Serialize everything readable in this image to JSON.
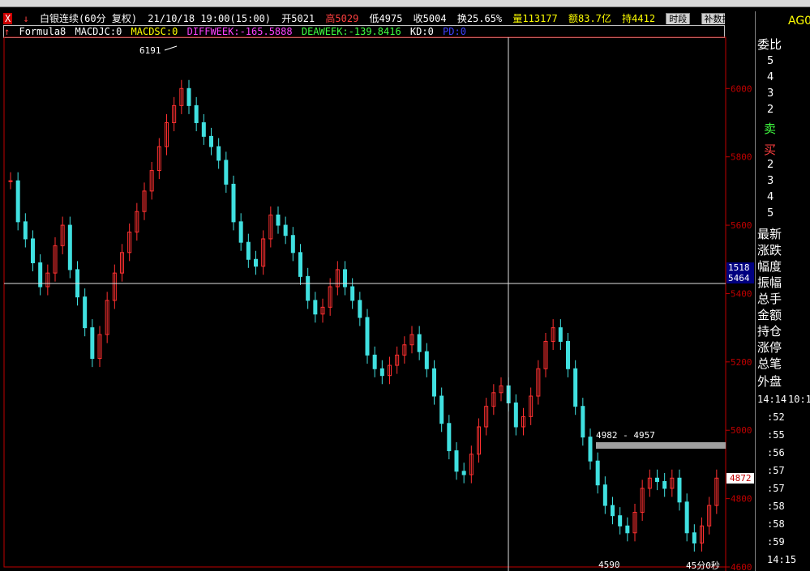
{
  "header": {
    "symbol_name": "白银连续(60分 复权)",
    "datetime": "21/10/18 19:00(15:00)",
    "open": "开5021",
    "high": "高5029",
    "low": "低4975",
    "close": "收5004",
    "turnover": "换25.65%",
    "volume": "量113177",
    "amount": "额83.7亿",
    "position": "持4412",
    "btn_period": "时段",
    "btn_fill": "补数据"
  },
  "formula": {
    "name": "Formula8",
    "macdjc": "MACDJC:0",
    "macdsc": "MACDSC:0",
    "diffweek": "DIFFWEEK:-165.5888",
    "deaweek": "DEAWEEK:-139.8416",
    "kd": "KD:0",
    "pd": "PD:0"
  },
  "panel": {
    "code": "AG0",
    "weibi": "委比",
    "sell": "卖",
    "buy": "买",
    "levels": [
      "5",
      "4",
      "3",
      "2",
      "2",
      "3",
      "4",
      "5"
    ],
    "fields": [
      "最新",
      "涨跌",
      "幅度",
      "振幅",
      "总手",
      "金额",
      "持仓",
      "涨停",
      "总笔"
    ],
    "outer": "外盘",
    "times": [
      "14:14",
      "10:1",
      ":52",
      ":55",
      ":56",
      ":57",
      ":57",
      ":58",
      ":58",
      ":59",
      "14:15"
    ]
  },
  "chart_data": {
    "type": "candlestick",
    "yaxis": {
      "ticks": [
        6000,
        5800,
        5600,
        5400,
        5200,
        5000,
        4800,
        4600
      ],
      "range": [
        4600,
        6150
      ]
    },
    "annotations": {
      "high_label": "6191",
      "low_label": "4590",
      "range_label": "4982 - 4957",
      "timer": "45分0秒",
      "cursor_price_top": "1518",
      "cursor_price_bottom": "5464",
      "last_price": "4872"
    },
    "close_series": [
      5730,
      5610,
      5560,
      5490,
      5420,
      5460,
      5540,
      5600,
      5470,
      5390,
      5300,
      5210,
      5280,
      5380,
      5460,
      5520,
      5580,
      5640,
      5700,
      5760,
      5830,
      5900,
      5950,
      6000,
      5950,
      5900,
      5860,
      5830,
      5790,
      5720,
      5610,
      5550,
      5500,
      5480,
      5560,
      5630,
      5600,
      5570,
      5520,
      5450,
      5380,
      5340,
      5360,
      5420,
      5470,
      5420,
      5380,
      5330,
      5220,
      5180,
      5160,
      5190,
      5220,
      5250,
      5280,
      5230,
      5180,
      5100,
      5020,
      4940,
      4880,
      4870,
      4930,
      5010,
      5070,
      5110,
      5130,
      5080,
      5010,
      5040,
      5100,
      5180,
      5260,
      5300,
      5260,
      5180,
      5070,
      4980,
      4910,
      4840,
      4780,
      4750,
      4720,
      4700,
      4760,
      4830,
      4860,
      4850,
      4830,
      4860,
      4790,
      4700,
      4670,
      4720,
      4780,
      4860
    ]
  }
}
